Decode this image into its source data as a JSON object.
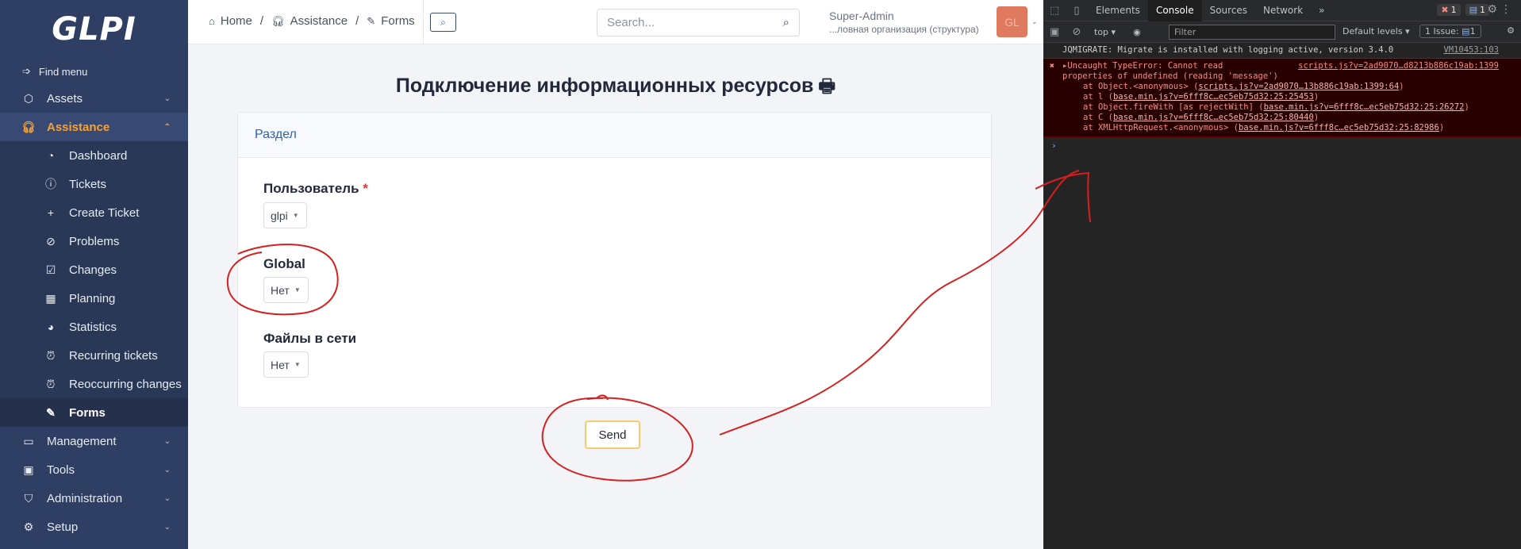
{
  "sidebar": {
    "logo": "GLPI",
    "find_menu": "Find menu",
    "items": [
      {
        "label": "Assets",
        "icon": "box-icon"
      },
      {
        "label": "Assistance",
        "icon": "headset-icon"
      }
    ],
    "sub_items": [
      {
        "label": "Dashboard",
        "icon": "gauge-icon"
      },
      {
        "label": "Tickets",
        "icon": "info-circle-icon"
      },
      {
        "label": "Create Ticket",
        "icon": "plus-icon"
      },
      {
        "label": "Problems",
        "icon": "alert-circle-icon"
      },
      {
        "label": "Changes",
        "icon": "clipboard-check-icon"
      },
      {
        "label": "Planning",
        "icon": "calendar-icon"
      },
      {
        "label": "Statistics",
        "icon": "pie-chart-icon"
      },
      {
        "label": "Recurring tickets",
        "icon": "alarm-icon"
      },
      {
        "label": "Reoccurring changes",
        "icon": "alarm-icon"
      },
      {
        "label": "Forms",
        "icon": "edit-icon"
      }
    ],
    "bottom_items": [
      {
        "label": "Management",
        "icon": "wallet-icon"
      },
      {
        "label": "Tools",
        "icon": "briefcase-icon"
      },
      {
        "label": "Administration",
        "icon": "shield-icon"
      },
      {
        "label": "Setup",
        "icon": "gear-icon"
      }
    ]
  },
  "topbar": {
    "breadcrumb": {
      "home": "Home",
      "sep": "/",
      "assistance": "Assistance",
      "forms": "Forms"
    },
    "search_placeholder": "Search...",
    "user_name": "Super-Admin",
    "user_org": "...ловная организация (структура)",
    "avatar_initials": "GL"
  },
  "form": {
    "title": "Подключение информационных ресурсов",
    "section": "Раздел",
    "fields": [
      {
        "label": "Пользователь",
        "required": "*",
        "value": "glpi"
      },
      {
        "label": "Global",
        "value": "Нет"
      },
      {
        "label": "Файлы в сети",
        "value": "Нет"
      }
    ],
    "send": "Send"
  },
  "devtools": {
    "tabs": [
      "Elements",
      "Console",
      "Sources",
      "Network"
    ],
    "more_tabs": "»",
    "errors_count": "1",
    "messages_count": "1",
    "context": "top",
    "filter_placeholder": "Filter",
    "levels": "Default levels",
    "issues": "1 Issue:",
    "issues_count": "1",
    "console": {
      "info": {
        "text": "JQMIGRATE: Migrate is installed with logging active, version 3.4.0",
        "source": "VM10453:103"
      },
      "error": {
        "line1": "Uncaught TypeError: Cannot read",
        "line2": "properties of undefined (reading 'message')",
        "source": "scripts.js?v=2ad9070…d8213b886c19ab:1399",
        "stack": [
          {
            "prefix": "at Object.<anonymous> (",
            "link": "scripts.js?v=2ad9070…13b886c19ab:1399:64",
            "suffix": ")"
          },
          {
            "prefix": "at l (",
            "link": "base.min.js?v=6fff8c…ec5eb75d32:25:25453",
            "suffix": ")"
          },
          {
            "prefix": "at Object.fireWith [as rejectWith] (",
            "link": "base.min.js?v=6fff8c…ec5eb75d32:25:26272",
            "suffix": ")"
          },
          {
            "prefix": "at C (",
            "link": "base.min.js?v=6fff8c…ec5eb75d32:25:80440",
            "suffix": ")"
          },
          {
            "prefix": "at XMLHttpRequest.<anonymous> (",
            "link": "base.min.js?v=6fff8c…ec5eb75d32:25:82986",
            "suffix": ")"
          }
        ]
      },
      "prompt": "›"
    }
  },
  "colors": {
    "sidebar": "#2f3f64",
    "accent": "#f6a233",
    "link": "#2a63b8",
    "annotation": "#d61f1f"
  }
}
